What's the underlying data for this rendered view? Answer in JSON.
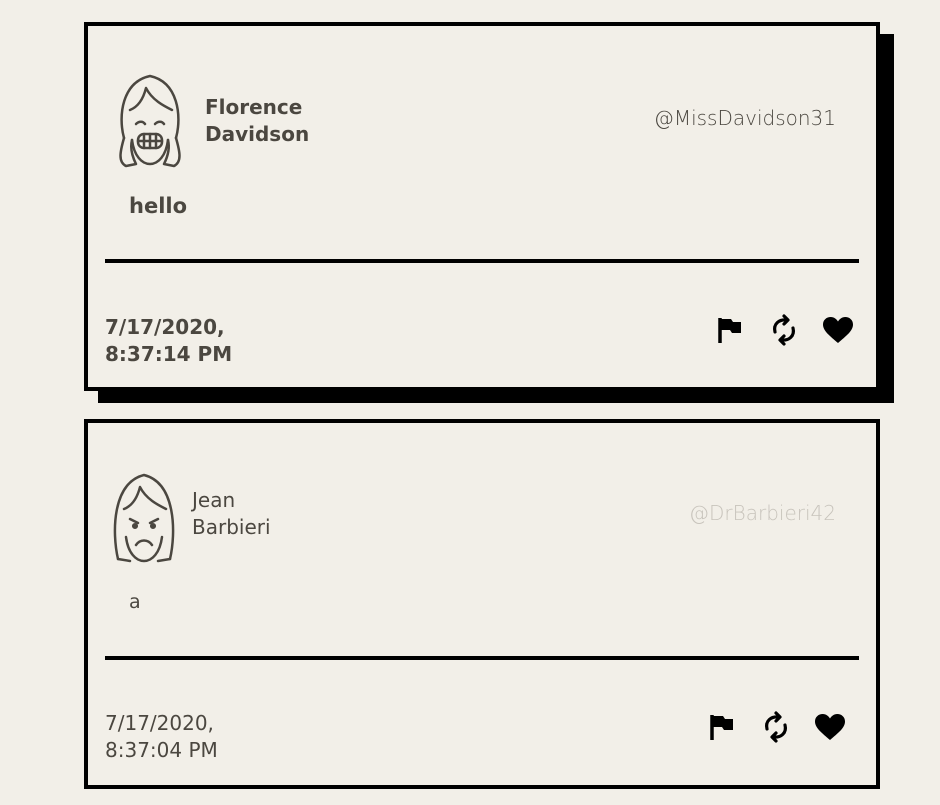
{
  "tweets": [
    {
      "name_first": "Florence",
      "name_last": "Davidson",
      "handle": "@MissDavidson31",
      "content": "hello",
      "date_line1": "7/17/2020,",
      "date_line2": "8:37:14 PM",
      "avatar_icon": "smiling-girl-avatar-icon",
      "actions": [
        "flag-icon",
        "retweet-icon",
        "heart-icon"
      ]
    },
    {
      "name_first": "Jean",
      "name_last": "Barbieri",
      "handle": "@DrBarbieri42",
      "content": "a",
      "date_line1": "7/17/2020,",
      "date_line2": "8:37:04 PM",
      "avatar_icon": "sad-girl-avatar-icon",
      "actions": [
        "flag-icon",
        "retweet-icon",
        "heart-icon"
      ]
    }
  ]
}
